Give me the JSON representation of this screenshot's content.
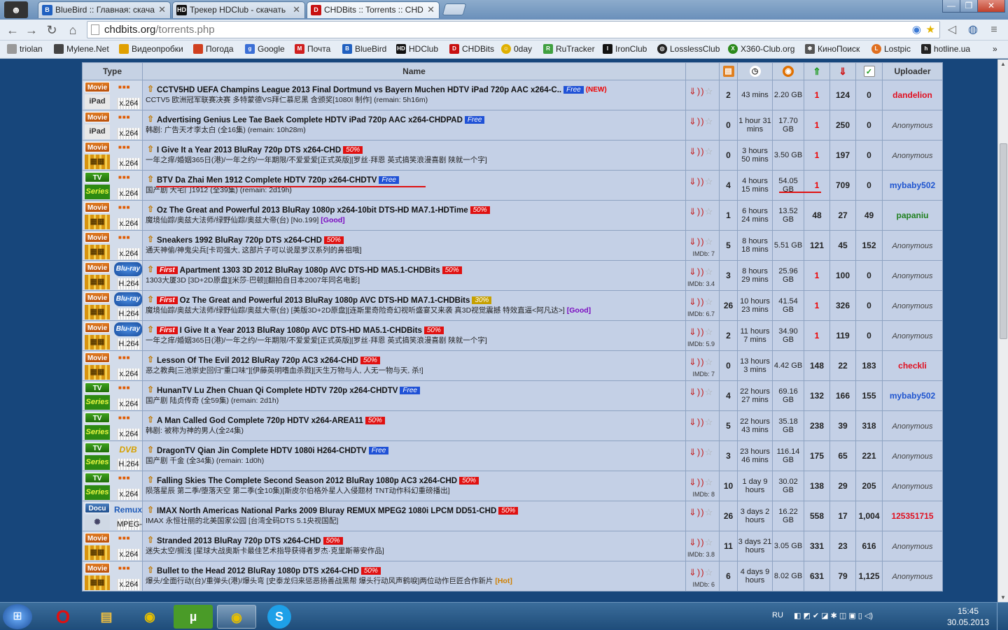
{
  "browser": {
    "tabs": [
      {
        "title": "BlueBird :: Главная: скача",
        "icon_color": "#2060c0"
      },
      {
        "title": "Трекер HDClub - скачать",
        "icon_color": "#111111"
      },
      {
        "title": "CHDBits :: Torrents :: CHD",
        "icon_color": "#c81010"
      }
    ],
    "url_host": "chdbits.org",
    "url_path": "/torrents.php",
    "bookmarks": [
      {
        "label": "triolan",
        "icon": "doc-icon",
        "color": "#999999"
      },
      {
        "label": "Mylene.Net",
        "icon": "photo-icon",
        "color": "#444444"
      },
      {
        "label": "Видеопробки",
        "icon": "traffic-icon",
        "color": "#e0a000"
      },
      {
        "label": "Погода",
        "icon": "weather-icon",
        "color": "#d04020"
      },
      {
        "label": "Google",
        "icon": "google-icon",
        "color": "#3b6fd6"
      },
      {
        "label": "Почта",
        "icon": "mail-icon",
        "color": "#d02020"
      },
      {
        "label": "BlueBird",
        "icon": "bluebird-icon",
        "color": "#2060c0"
      },
      {
        "label": "HDClub",
        "icon": "hdclub-icon",
        "color": "#111111"
      },
      {
        "label": "CHDBits",
        "icon": "chdbits-icon",
        "color": "#c81010"
      },
      {
        "label": "0day",
        "icon": "smile-icon",
        "color": "#e0b000"
      },
      {
        "label": "RuTracker",
        "icon": "rutracker-icon",
        "color": "#40a040"
      },
      {
        "label": "IronClub",
        "icon": "ironclub-icon",
        "color": "#111111"
      },
      {
        "label": "LosslessClub",
        "icon": "lossless-icon",
        "color": "#222222"
      },
      {
        "label": "X360-Club.org",
        "icon": "xbox-icon",
        "color": "#2c8a1c"
      },
      {
        "label": "КиноПоиск",
        "icon": "kinopoisk-icon",
        "color": "#555555"
      },
      {
        "label": "Lostpic",
        "icon": "lostpic-icon",
        "color": "#e07020"
      },
      {
        "label": "hotline.ua",
        "icon": "hotline-icon",
        "color": "#222222"
      }
    ]
  },
  "table": {
    "headers": {
      "type": "Type",
      "name": "Name",
      "uploader": "Uploader"
    },
    "rows": [
      {
        "cat": "Movie",
        "cat_class": "movie",
        "sub": "iPad",
        "sub_class": "ipad",
        "media": "",
        "media_class": "",
        "codec": "x.264",
        "first": "",
        "title": "CCTV5HD UEFA Champins League 2013 Final Dortmund vs Bayern Muchen HDTV iPad 720p AAC x264-C..",
        "tag": "Free",
        "tag_class": "free",
        "extra": "(NEW)",
        "desc": "CCTV5 欧洲冠军联赛决赛 多特蒙德VS拜仁慕尼黑 含颁奖[1080I 制作] (remain: 5h16m)",
        "desc_extra": "",
        "imdb": "",
        "comments": "2",
        "time": "43 mins",
        "size": "2.20 GB",
        "seeders": "1",
        "leechers": "124",
        "snatched": "0",
        "uploader": "dandelion",
        "up_color": "#e01020",
        "up_anon": false
      },
      {
        "cat": "Movie",
        "cat_class": "movie",
        "sub": "iPad",
        "sub_class": "ipad",
        "media": "",
        "media_class": "",
        "codec": "x.264",
        "first": "",
        "title": "Advertising Genius Lee Tae Baek Complete HDTV iPad 720p AAC x264-CHDPAD",
        "tag": "Free",
        "tag_class": "free",
        "extra": "",
        "desc": "韩剧: 广告天才李太白 (全16集) (remain: 10h28m)",
        "desc_extra": "",
        "imdb": "",
        "comments": "0",
        "time": "1 hour 31 mins",
        "size": "17.70 GB",
        "seeders": "1",
        "leechers": "250",
        "snatched": "0",
        "uploader": "Anonymous",
        "up_color": "#444444",
        "up_anon": true
      },
      {
        "cat": "Movie",
        "cat_class": "movie",
        "sub": "",
        "sub_class": "film",
        "media": "",
        "media_class": "",
        "codec": "x.264",
        "first": "",
        "title": "I Give It a Year 2013 BluRay 720p DTS x264-CHD",
        "tag": "50%",
        "tag_class": "p50",
        "extra": "",
        "desc": "一年之痒/婚姻365日(港)/一年之约/一年期限/不爱爱爱[正式英版][罗丝·拜恩 英式搞笑浪漫喜剧 陕就一个字]",
        "desc_extra": "",
        "imdb": "",
        "comments": "0",
        "time": "3 hours 50 mins",
        "size": "3.50 GB",
        "seeders": "1",
        "leechers": "197",
        "snatched": "0",
        "uploader": "Anonymous",
        "up_color": "#444444",
        "up_anon": true
      },
      {
        "cat": "TV",
        "cat_class": "tv",
        "sub": "Series",
        "sub_class": "series",
        "media": "",
        "media_class": "",
        "codec": "x.264",
        "first": "",
        "title": "BTV Da Zhai Men 1912 Complete HDTV 720p x264-CHDTV",
        "tag": "Free",
        "tag_class": "free",
        "extra": "",
        "desc": "国产剧 大宅门1912 (全39集) (remain: 2d19h)",
        "desc_extra": "",
        "imdb": "",
        "comments": "4",
        "time": "4 hours 15 mins",
        "size": "54.05 GB",
        "seeders": "1",
        "leechers": "709",
        "snatched": "0",
        "uploader": "mybaby502",
        "up_color": "#1f55d0",
        "up_anon": false
      },
      {
        "cat": "Movie",
        "cat_class": "movie",
        "sub": "",
        "sub_class": "film",
        "media": "",
        "media_class": "",
        "codec": "x.264",
        "first": "",
        "title": "Oz The Great and Powerful 2013 BluRay 1080p x264-10bit DTS-HD MA7.1-HDTime",
        "tag": "50%",
        "tag_class": "p50",
        "extra": "",
        "desc": "魔境仙踪/奥兹大法师/绿野仙踪/奥兹大帝(台) [No.199]",
        "desc_extra": "[Good]",
        "desc_extra_class": "good",
        "imdb": "",
        "comments": "1",
        "time": "6 hours 24 mins",
        "size": "13.52 GB",
        "seeders": "48",
        "leechers": "27",
        "snatched": "49",
        "uploader": "papaniu",
        "up_color": "#208020",
        "up_anon": false
      },
      {
        "cat": "Movie",
        "cat_class": "movie",
        "sub": "",
        "sub_class": "film",
        "media": "",
        "media_class": "",
        "codec": "x.264",
        "first": "",
        "title": "Sneakers 1992 BluRay 720p DTS x264-CHD",
        "tag": "50%",
        "tag_class": "p50",
        "extra": "",
        "desc": "通天神偷/神鬼尖兵[卡司强大, 这部片子可以说是罗汉系列的鼻祖哦]",
        "desc_extra": "",
        "imdb": "IMDb: 7",
        "comments": "5",
        "time": "8 hours 18 mins",
        "size": "5.51 GB",
        "seeders": "121",
        "leechers": "45",
        "snatched": "152",
        "uploader": "Anonymous",
        "up_color": "#444444",
        "up_anon": true
      },
      {
        "cat": "Movie",
        "cat_class": "movie",
        "sub": "",
        "sub_class": "film",
        "media": "Blu-ray",
        "media_class": "bluray",
        "codec": "H.264",
        "first": "First",
        "title": "Apartment 1303 3D 2012 BluRay 1080p AVC DTS-HD MA5.1-CHDBits",
        "tag": "50%",
        "tag_class": "p50",
        "extra": "",
        "desc": "1303大厦3D [3D+2D原盘][米莎·巴顿][翻拍自日本2007年同名电影]",
        "desc_extra": "",
        "imdb": "IMDb: 3.4",
        "comments": "3",
        "time": "8 hours 29 mins",
        "size": "25.96 GB",
        "seeders": "1",
        "leechers": "100",
        "snatched": "0",
        "uploader": "Anonymous",
        "up_color": "#444444",
        "up_anon": true
      },
      {
        "cat": "Movie",
        "cat_class": "movie",
        "sub": "",
        "sub_class": "film",
        "media": "Blu-ray",
        "media_class": "bluray",
        "codec": "H.264",
        "first": "First",
        "title": "Oz The Great and Powerful 2013 BluRay 1080p AVC DTS-HD MA7.1-CHDBits",
        "tag": "30%",
        "tag_class": "p30",
        "extra": "",
        "desc": "魔境仙踪/奥兹大法师/绿野仙踪/奥兹大帝(台) [美版3D+2D原盘][连斯里奇险奇幻视听盛宴又来袭 真3D视觉震撼 特效直逼<阿凡达>]",
        "desc_extra": "[Good]",
        "desc_extra_class": "good",
        "imdb": "IMDb: 6.7",
        "comments": "26",
        "time": "10 hours 23 mins",
        "size": "41.54 GB",
        "seeders": "1",
        "leechers": "326",
        "snatched": "0",
        "uploader": "Anonymous",
        "up_color": "#444444",
        "up_anon": true
      },
      {
        "cat": "Movie",
        "cat_class": "movie",
        "sub": "",
        "sub_class": "film",
        "media": "Blu-ray",
        "media_class": "bluray",
        "codec": "H.264",
        "first": "First",
        "title": "I Give It a Year 2013 BluRay 1080p AVC DTS-HD MA5.1-CHDBits",
        "tag": "50%",
        "tag_class": "p50",
        "extra": "",
        "desc": "一年之痒/婚姻365日(港)/一年之约/一年期限/不爱爱爱[正式英版][罗丝·拜恩 英式搞笑浪漫喜剧 陕就一个字]",
        "desc_extra": "",
        "imdb": "IMDb: 5.9",
        "comments": "2",
        "time": "11 hours 7 mins",
        "size": "34.90 GB",
        "seeders": "1",
        "leechers": "119",
        "snatched": "0",
        "uploader": "Anonymous",
        "up_color": "#444444",
        "up_anon": true
      },
      {
        "cat": "Movie",
        "cat_class": "movie",
        "sub": "",
        "sub_class": "film",
        "media": "",
        "media_class": "",
        "codec": "x.264",
        "first": "",
        "title": "Lesson Of The Evil 2012 BluRay 720p AC3 x264-CHD",
        "tag": "50%",
        "tag_class": "p50",
        "extra": "",
        "desc": "恶之教典[三池崇史回归\"重口味\"][伊藤英明嗜血杀戮][天生万物与人, 人无一物与天, 杀!]",
        "desc_extra": "",
        "imdb": "IMDb: 7",
        "comments": "0",
        "time": "13 hours 3 mins",
        "size": "4.42 GB",
        "seeders": "148",
        "leechers": "22",
        "snatched": "183",
        "uploader": "checkli",
        "up_color": "#e01020",
        "up_anon": false
      },
      {
        "cat": "TV",
        "cat_class": "tv",
        "sub": "Series",
        "sub_class": "series",
        "media": "",
        "media_class": "",
        "codec": "x.264",
        "first": "",
        "title": "HunanTV Lu Zhen Chuan Qi Complete HDTV 720p x264-CHDTV",
        "tag": "Free",
        "tag_class": "free",
        "extra": "",
        "desc": "国产剧 陆贞传奇 (全59集) (remain: 2d1h)",
        "desc_extra": "",
        "imdb": "",
        "comments": "4",
        "time": "22 hours 27 mins",
        "size": "69.16 GB",
        "seeders": "132",
        "leechers": "166",
        "snatched": "155",
        "uploader": "mybaby502",
        "up_color": "#1f55d0",
        "up_anon": false
      },
      {
        "cat": "TV",
        "cat_class": "tv",
        "sub": "Series",
        "sub_class": "series",
        "media": "",
        "media_class": "",
        "codec": "x.264",
        "first": "",
        "title": "A Man Called God Complete 720p HDTV x264-AREA11",
        "tag": "50%",
        "tag_class": "p50",
        "extra": "",
        "desc": "韩剧: 被称为神的男人(全24集)",
        "desc_extra": "",
        "imdb": "",
        "comments": "5",
        "time": "22 hours 43 mins",
        "size": "35.18 GB",
        "seeders": "238",
        "leechers": "39",
        "snatched": "318",
        "uploader": "Anonymous",
        "up_color": "#444444",
        "up_anon": true
      },
      {
        "cat": "TV",
        "cat_class": "tv",
        "sub": "Series",
        "sub_class": "series",
        "media": "DVB",
        "media_class": "dvd",
        "codec": "H.264",
        "first": "",
        "title": "DragonTV Qian Jin Complete HDTV 1080i H264-CHDTV",
        "tag": "Free",
        "tag_class": "free",
        "extra": "",
        "desc": "国产剧 千金 (全34集) (remain: 1d0h)",
        "desc_extra": "",
        "imdb": "",
        "comments": "3",
        "time": "23 hours 46 mins",
        "size": "116.14 GB",
        "seeders": "175",
        "leechers": "65",
        "snatched": "221",
        "uploader": "Anonymous",
        "up_color": "#444444",
        "up_anon": true
      },
      {
        "cat": "TV",
        "cat_class": "tv",
        "sub": "Series",
        "sub_class": "series",
        "media": "",
        "media_class": "",
        "codec": "x.264",
        "first": "",
        "title": "Falling Skies The Complete Second Season 2012 BluRay 1080p AC3 x264-CHD",
        "tag": "50%",
        "tag_class": "p50",
        "extra": "",
        "desc": "陨落星辰 第二季/堕落天空 第二季(全10集)[斯皮尔伯格外星人入侵题材 TNT动作科幻重磅播出]",
        "desc_extra": "",
        "imdb": "IMDb: 8",
        "comments": "10",
        "time": "1 day 9 hours",
        "size": "30.02 GB",
        "seeders": "138",
        "leechers": "29",
        "snatched": "205",
        "uploader": "Anonymous",
        "up_color": "#444444",
        "up_anon": true
      },
      {
        "cat": "Docu",
        "cat_class": "docu",
        "sub": "",
        "sub_class": "docuimg",
        "media": "Remux",
        "media_class": "remux",
        "codec": "MPEG-2",
        "first": "",
        "title": "IMAX North Americas National Parks 2009 Bluray REMUX MPEG2 1080i LPCM DD51-CHD",
        "tag": "50%",
        "tag_class": "p50",
        "extra": "",
        "desc": "IMAX 永恒壮丽的北美国家公园 [台湾全码DTS 5.1央视国配]",
        "desc_extra": "",
        "imdb": "",
        "comments": "26",
        "time": "3 days 2 hours",
        "size": "16.22 GB",
        "seeders": "558",
        "leechers": "17",
        "snatched": "1,004",
        "uploader": "125351715",
        "up_color": "#e01020",
        "up_anon": false
      },
      {
        "cat": "Movie",
        "cat_class": "movie",
        "sub": "",
        "sub_class": "film",
        "media": "",
        "media_class": "",
        "codec": "x.264",
        "first": "",
        "title": "Stranded 2013 BluRay 720p DTS x264-CHD",
        "tag": "50%",
        "tag_class": "p50",
        "extra": "",
        "desc": "迷失太空/搁浅 [星球大战奥斯卡最佳艺术指导获得者罗杰·克里斯蒂安作品]",
        "desc_extra": "",
        "imdb": "IMDb: 3.8",
        "comments": "11",
        "time": "3 days 21 hours",
        "size": "3.05 GB",
        "seeders": "331",
        "leechers": "23",
        "snatched": "616",
        "uploader": "Anonymous",
        "up_color": "#444444",
        "up_anon": true
      },
      {
        "cat": "Movie",
        "cat_class": "movie",
        "sub": "",
        "sub_class": "film",
        "media": "",
        "media_class": "",
        "codec": "x.264",
        "first": "",
        "title": "Bullet to the Head 2012 BluRay 1080p DTS x264-CHD",
        "tag": "50%",
        "tag_class": "p50",
        "extra": "",
        "desc": "爆头/全面行动(台)/重弹头(港)/爆头弯 [史泰龙归来惩恶扬善战黑帮 爆头行动风声鹤唳]两位动作巨匠合作新片",
        "desc_extra": "[Hot]",
        "desc_extra_class": "hot",
        "imdb": "IMDb: 6",
        "comments": "6",
        "time": "4 days 9 hours",
        "size": "8.02 GB",
        "seeders": "631",
        "leechers": "79",
        "snatched": "1,125",
        "uploader": "Anonymous",
        "up_color": "#444444",
        "up_anon": true
      }
    ]
  },
  "taskbar": {
    "apps": [
      "Opera",
      "Explorer",
      "Chrome",
      "uTorrent",
      "Chrome",
      "Skype"
    ],
    "lang": "RU",
    "time": "15:45",
    "date": "30.05.2013"
  }
}
